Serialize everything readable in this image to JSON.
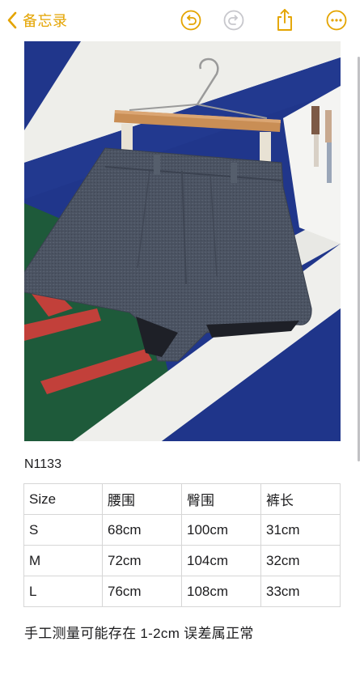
{
  "nav": {
    "back_label": "备忘录"
  },
  "colors": {
    "accent": "#e4a400",
    "disabled": "#c7c7cc"
  },
  "icons": {
    "back": "chevron-left-icon",
    "undo": "undo-icon",
    "redo": "redo-icon",
    "share": "share-icon",
    "more": "more-icon"
  },
  "product": {
    "code": "N1133"
  },
  "size_table": {
    "header": [
      "Size",
      "腰围",
      "臀围",
      "裤长"
    ],
    "rows": [
      [
        "S",
        "68cm",
        "100cm",
        "31cm"
      ],
      [
        "M",
        "72cm",
        "104cm",
        "32cm"
      ],
      [
        "L",
        "76cm",
        "108cm",
        "33cm"
      ]
    ]
  },
  "note": "手工测量可能存在 1-2cm 误差属正常"
}
